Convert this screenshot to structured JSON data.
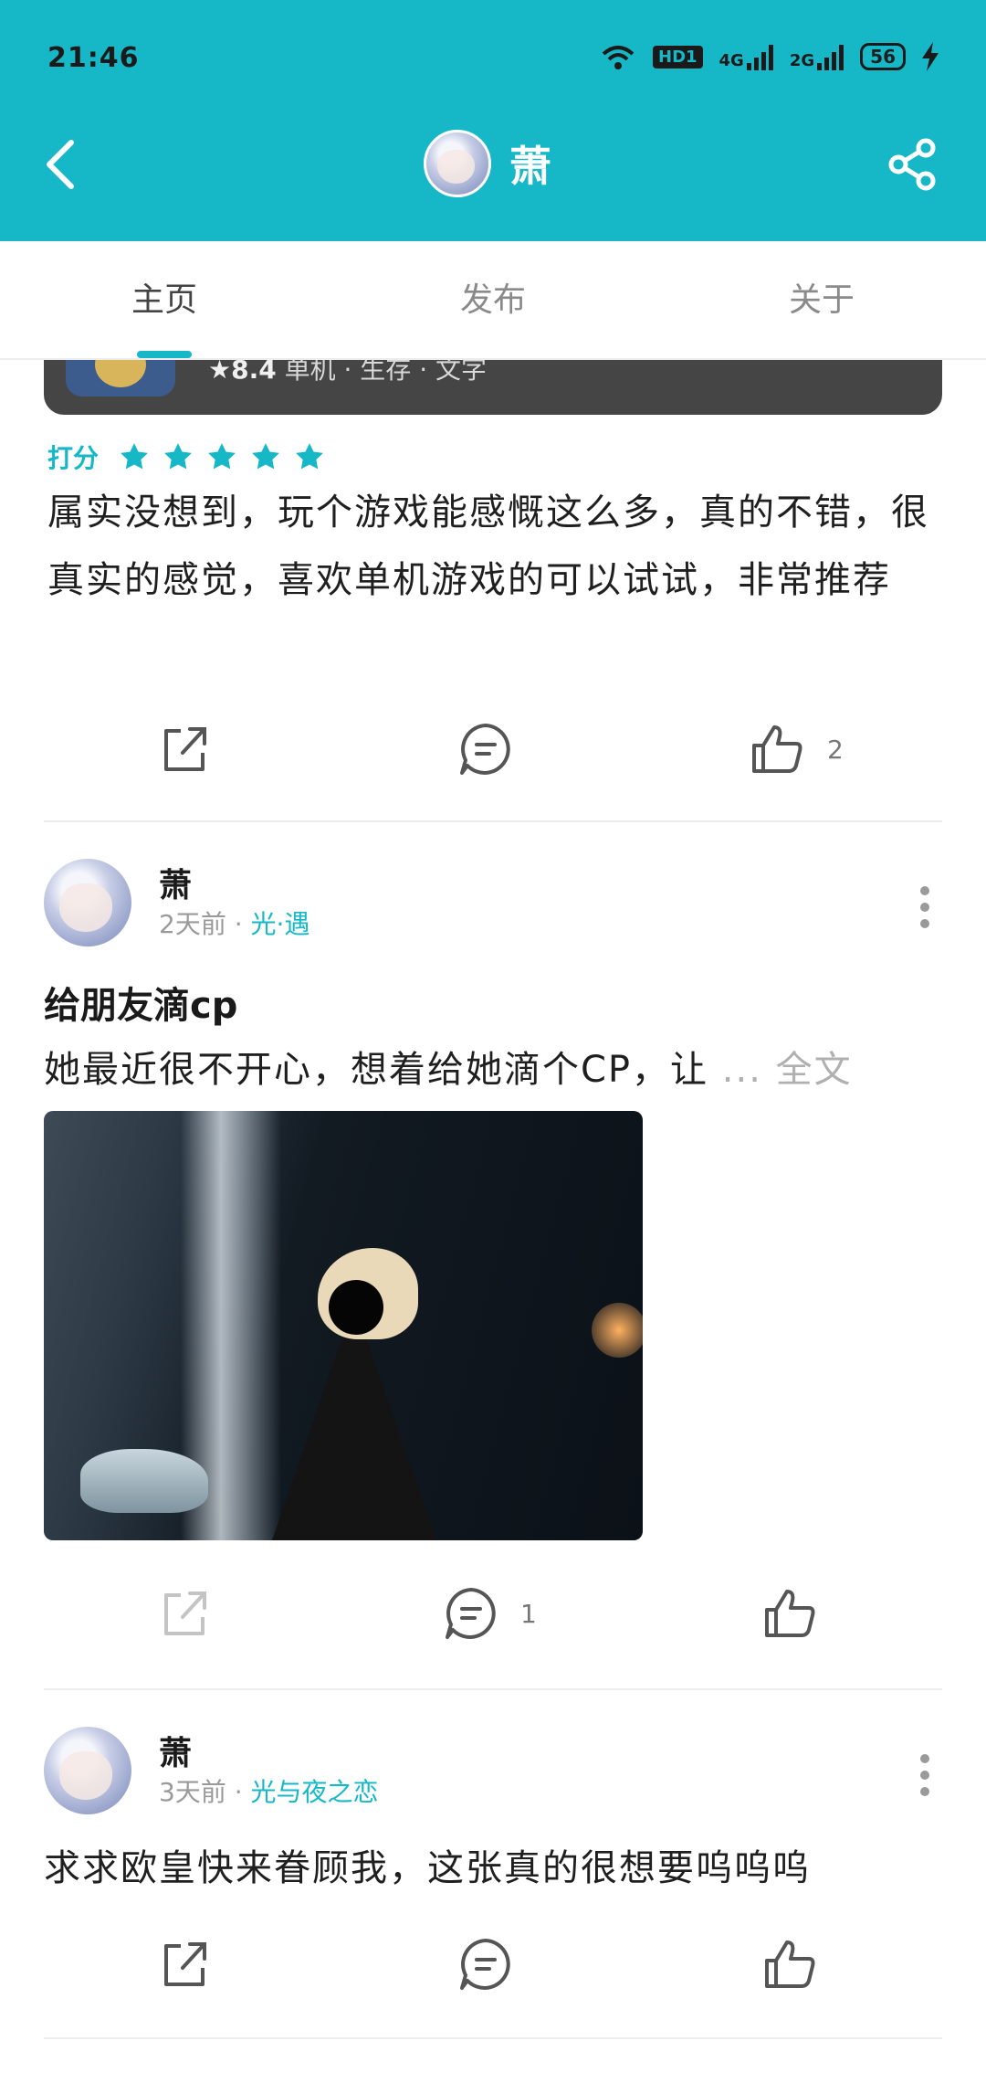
{
  "status_bar": {
    "time": "21:46",
    "hd_label": "HD1",
    "net1": "4G",
    "net2": "2G",
    "battery": "56"
  },
  "header": {
    "title": "萧",
    "accent_color": "#16b8c8"
  },
  "tabs": [
    {
      "label": "主页",
      "active": true
    },
    {
      "label": "发布",
      "active": false
    },
    {
      "label": "关于",
      "active": false
    }
  ],
  "posts": [
    {
      "game_card": {
        "score": "★8.4",
        "meta": "单机 · 生存 · 文字"
      },
      "rating_label": "打分",
      "rating_stars": 5,
      "body": "属实没想到，玩个游戏能感慨这么多，真的不错，很真实的感觉，喜欢单机游戏的可以试试，非常推荐",
      "comment_count": "",
      "like_count": "2"
    },
    {
      "author": "萧",
      "time": "2天前",
      "tag": "光·遇",
      "title": "给朋友滴cp",
      "preview": "她最近很不开心，想着给她滴个CP，让",
      "full_text_link": "... 全文",
      "comment_count": "1",
      "like_count": ""
    },
    {
      "author": "萧",
      "time": "3天前",
      "tag": "光与夜之恋",
      "body": "求求欧皇快来眷顾我，这张真的很想要呜呜呜",
      "comment_count": "",
      "like_count": ""
    }
  ]
}
